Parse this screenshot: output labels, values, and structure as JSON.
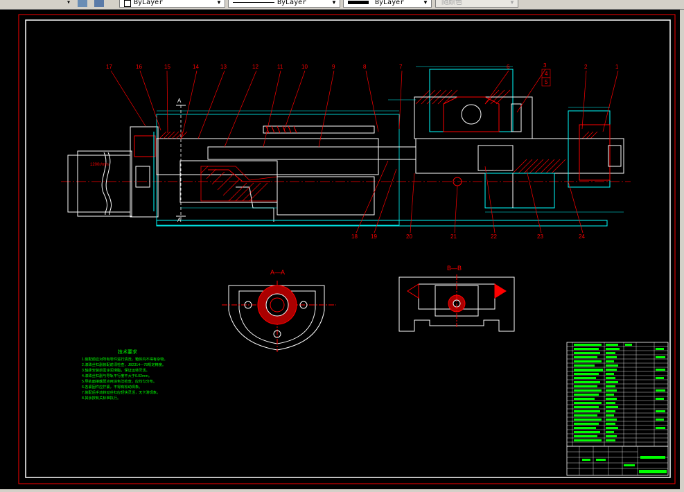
{
  "toolbar": {
    "layer_combo_text": "ByLayer",
    "linetype_combo_text": "ByLayer",
    "lineweight_combo_text": "ByLayer",
    "plotstyle_combo_text": "随颜色"
  },
  "drawing": {
    "part_numbers_top": [
      "17",
      "16",
      "15",
      "14",
      "13",
      "12",
      "11",
      "10",
      "9",
      "8",
      "7",
      "6",
      "5",
      "4",
      "3",
      "2",
      "1"
    ],
    "part_numbers_bottom": [
      "18",
      "19",
      "20",
      "21",
      "22",
      "23",
      "24"
    ],
    "section_a_label": "A—A",
    "section_b_label": "B—B",
    "cut_mark_a": "A",
    "motor_label": "1200r/min",
    "notes_title": "技术要求",
    "notes": [
      "1.装配前应对所有零件进行清洗，箱体内不得有杂物。",
      "2.滚珠丝杠副装配前须检查，JB2314—78规定精度。",
      "3.轴承安装前需涂润滑脂，保证运转灵活。",
      "4.滚珠丝杠副与导轨平行度不大于0.02mm。",
      "5.导轨面接触斑点用涂色法检查，应均匀分布。",
      "6.各紧固件应拧紧，不得有松动现象。",
      "7.装配后手动转动丝杠应轻快灵活，无卡滞现象。",
      "8.其余按有关标准执行。"
    ]
  },
  "colors": {
    "background": "#000000",
    "border": "#ffffff",
    "frame_red": "#ff0000",
    "cyan": "#00ffff",
    "green": "#00ff00",
    "white": "#ffffff",
    "toolbar": "#d4d0c8"
  }
}
